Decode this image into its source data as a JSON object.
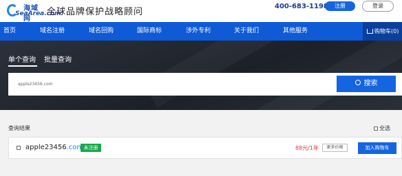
{
  "header": {
    "logo_cn": "海域网",
    "logo_en": "SeaArea.com",
    "slogan": "全球品牌保护战略顾问",
    "phone": "400-683-1198",
    "register_label": "注册",
    "login_label": "登录"
  },
  "nav": {
    "items": [
      {
        "label": "首页"
      },
      {
        "label": "域名注册"
      },
      {
        "label": "域名回购"
      },
      {
        "label": "国际商标"
      },
      {
        "label": "涉外专利"
      },
      {
        "label": "关于我们"
      },
      {
        "label": "其他服务"
      }
    ],
    "cart_label": "购物车(0)"
  },
  "search": {
    "tabs": [
      {
        "label": "单个查询",
        "active": true
      },
      {
        "label": "批量查询",
        "active": false
      }
    ],
    "input_value": "apple23456.com",
    "button_label": "搜索"
  },
  "results": {
    "title": "查询结果",
    "select_all_label": "全选",
    "rows": [
      {
        "domain_name": "apple23456",
        "domain_suffix": ".com",
        "status": "未注册",
        "price": "88元/1年",
        "more_price_label": "更多价格",
        "add_cart_label": "加入购物车"
      }
    ]
  },
  "colors": {
    "primary": "#1565e0",
    "nav_bg": "#0f5ad6",
    "status_green": "#18a84a",
    "price_red": "#e53935"
  }
}
